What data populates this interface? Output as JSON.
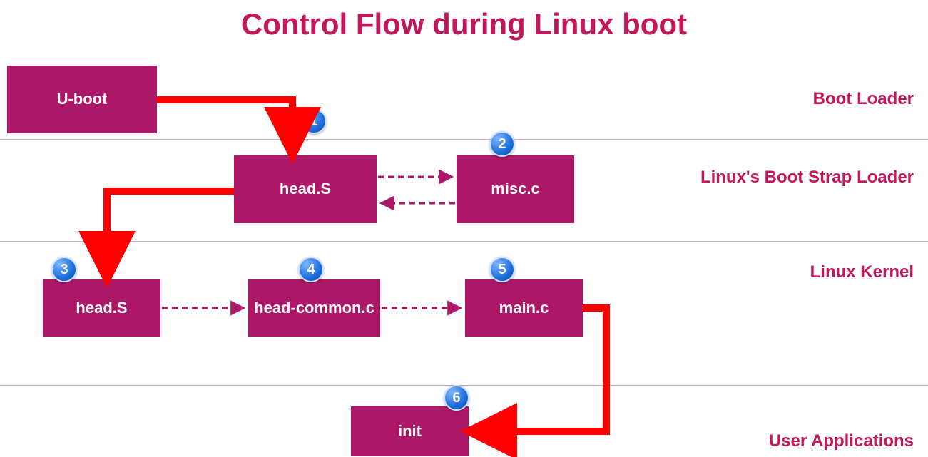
{
  "title": "Control Flow during Linux boot",
  "sections": {
    "s1": "Boot Loader",
    "s2": "Linux's Boot Strap Loader",
    "s3": "Linux Kernel",
    "s4": "User Applications"
  },
  "boxes": {
    "uboot": "U-boot",
    "headS1": "head.S",
    "misc": "misc.c",
    "headS2": "head.S",
    "headCommon": "head-common.c",
    "main": "main.c",
    "init": "init"
  },
  "badges": {
    "b1": "1",
    "b2": "2",
    "b3": "3",
    "b4": "4",
    "b5": "5",
    "b6": "6"
  }
}
